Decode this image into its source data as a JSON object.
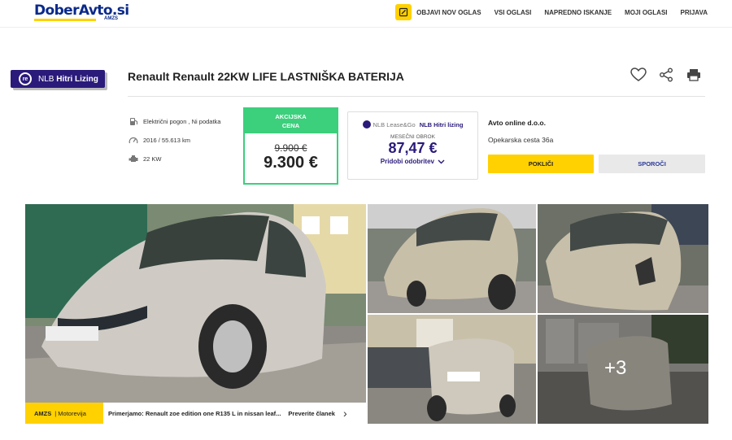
{
  "header": {
    "logo": "DoberAvto.si",
    "logo_sub": "AMZS",
    "nav": [
      "OBJAVI NOV OGLAS",
      "VSI OGLASI",
      "NAPREDNO ISKANJE",
      "MOJI OGLASI",
      "PRIJAVA"
    ]
  },
  "nlb_badge": {
    "brand": "NLB",
    "label": "Hitri Lizing",
    "mark": "re"
  },
  "listing": {
    "title": "Renault Renault 22KW LIFE LASTNIŠKA BATERIJA",
    "specs": [
      {
        "icon": "fuel-icon",
        "text": "Električni pogon , Ni podatka"
      },
      {
        "icon": "speedometer-icon",
        "text": "2016 / 55.613 km"
      },
      {
        "icon": "engine-icon",
        "text": "22 KW"
      }
    ]
  },
  "price": {
    "header_line1": "AKCIJSKA",
    "header_line2": "CENA",
    "old": "9.900 €",
    "new": "9.300 €"
  },
  "leasing": {
    "brand": "NLB",
    "brand_sub": "Lease&Go",
    "product": "NLB Hitri lizing",
    "label": "MESEČNI OBROK",
    "value": "87,47 €",
    "link": "Pridobi odobritev"
  },
  "dealer": {
    "name": "Avto online d.o.o.",
    "address": "Opekarska cesta 36a",
    "call_label": "POKLIČI",
    "message_label": "SPOROČI"
  },
  "gallery": {
    "more_count": "+3"
  },
  "banner": {
    "brand": "AMZS",
    "section": "Motorevija",
    "text": "Primerjamo: Renault zoe edition one R135 L in nissan leaf...",
    "link": "Preverite članek"
  },
  "colors": {
    "brand_blue": "#0a2a8a",
    "yellow": "#ffd100",
    "green": "#3ccf7c",
    "nlb_purple": "#2a1a7a"
  }
}
